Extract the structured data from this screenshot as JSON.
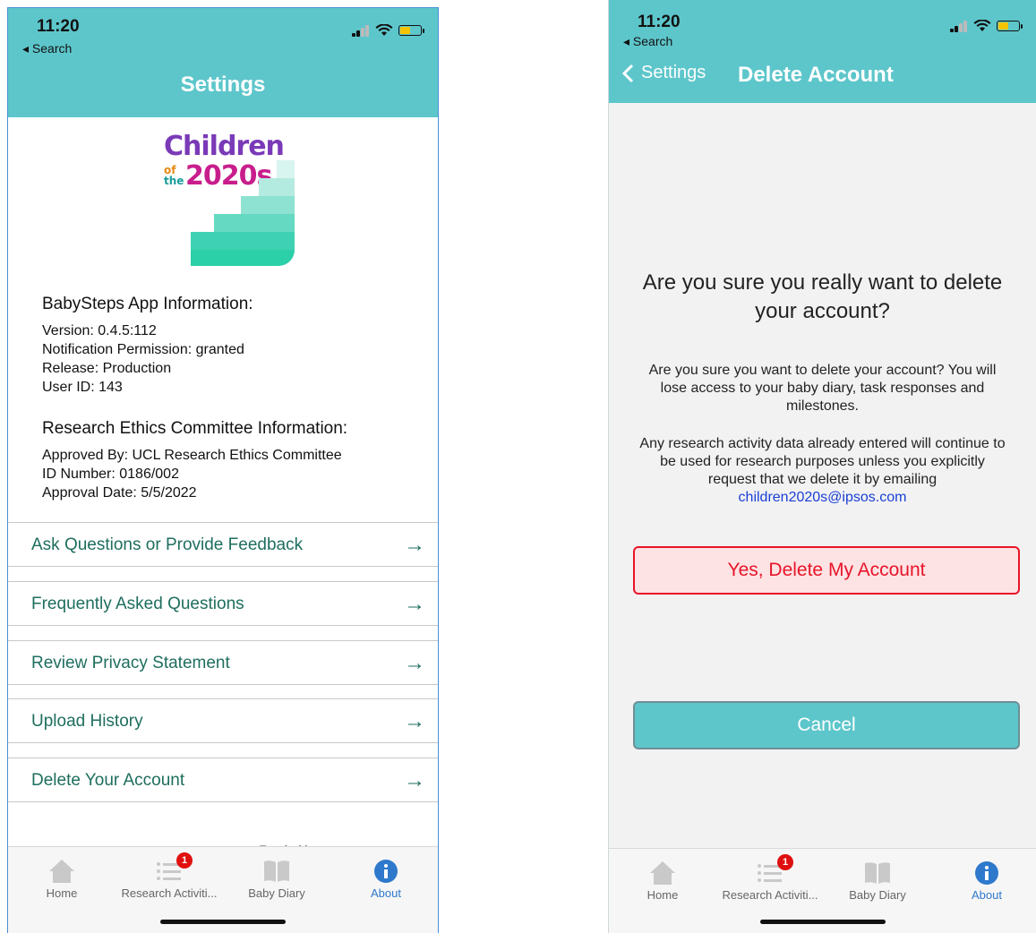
{
  "left": {
    "status": {
      "time": "11:20",
      "back_app": "◂ Search"
    },
    "header": {
      "title": "Settings"
    },
    "logo": {
      "line1": "Children",
      "of": "of",
      "the": "the",
      "year": "2020s"
    },
    "app_info": {
      "heading": "BabySteps App Information:",
      "lines": [
        "Version: 0.4.5:112",
        "Notification Permission: granted",
        "Release: Production",
        "User ID: 143"
      ]
    },
    "ethics_info": {
      "heading": "Research Ethics Committee Information:",
      "lines": [
        "Approved By: UCL Research Ethics Committee",
        "ID Number: 0186/002",
        "Approval Date: 5/5/2022"
      ]
    },
    "menu": [
      {
        "label": "Ask Questions or Provide Feedback"
      },
      {
        "label": "Frequently Asked Questions"
      },
      {
        "label": "Review Privacy Statement"
      },
      {
        "label": "Upload History"
      },
      {
        "label": "Delete Your Account"
      }
    ],
    "funded": "Funded by"
  },
  "right": {
    "status": {
      "time": "11:20",
      "back_app": "◂ Search"
    },
    "header": {
      "back_label": "Settings",
      "title": "Delete Account"
    },
    "question": "Are you sure you really want to delete your account?",
    "para1": "Are you sure you want to delete your account? You will lose access to your baby diary, task responses and milestones.",
    "para2": "Any research activity data already entered will continue to be used for research purposes unless you explicitly request that we delete it by emailing",
    "email": "children2020s@ipsos.com",
    "confirm_button": "Yes, Delete My Account",
    "cancel_button": "Cancel"
  },
  "tabs": [
    {
      "label": "Home",
      "icon": "home-icon"
    },
    {
      "label": "Research Activiti...",
      "icon": "list-icon",
      "badge": "1"
    },
    {
      "label": "Baby Diary",
      "icon": "book-icon"
    },
    {
      "label": "About",
      "icon": "info-icon"
    }
  ],
  "colors": {
    "header": "#5dc6cb",
    "accent_green": "#1e6e5e",
    "danger": "#e8142a",
    "active_tab": "#2f79cc"
  }
}
